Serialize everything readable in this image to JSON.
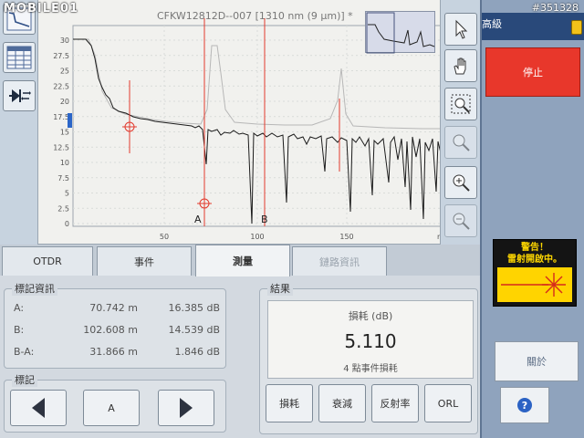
{
  "watermark": {
    "brand": "MOBILE01",
    "id": "#351328"
  },
  "graph": {
    "title": "CFKW12812D--007 [1310 nm (9 µm)] *",
    "x_ticks": [
      "50",
      "100",
      "150"
    ],
    "x_unit": "m",
    "y_ticks": [
      "30",
      "27.5",
      "25",
      "22.5",
      "20",
      "17.5",
      "15",
      "12.5",
      "10",
      "7.5",
      "5",
      "2.5",
      "0"
    ],
    "marker_a": "A",
    "marker_b": "B"
  },
  "left_tools": {
    "icons": [
      "trace-view-icon",
      "table-view-icon",
      "event-icon"
    ]
  },
  "right_tools": {
    "icons": [
      "pointer-icon",
      "hand-pan-icon",
      "zoom-area-icon",
      "zoom-reset-icon",
      "zoom-in-icon",
      "zoom-out-icon"
    ]
  },
  "side": {
    "level": "高級",
    "stop": "停止",
    "warning_line1": "警告！",
    "warning_line2": "雷射開啟中。",
    "about": "關於",
    "help": "?"
  },
  "tabs": [
    {
      "label": "OTDR"
    },
    {
      "label": "事件"
    },
    {
      "label": "測量"
    },
    {
      "label": "鏈路資訊"
    }
  ],
  "marker_info": {
    "legend": "標記資訊",
    "rows": [
      {
        "label": "A:",
        "distance": "70.742 m",
        "loss": "16.385 dB"
      },
      {
        "label": "B:",
        "distance": "102.608 m",
        "loss": "14.539 dB"
      },
      {
        "label": "B-A:",
        "distance": "31.866 m",
        "loss": "1.846 dB"
      }
    ]
  },
  "marker_ctrl": {
    "legend": "標記",
    "selected": "A"
  },
  "results": {
    "legend": "結果",
    "title": "損耗 (dB)",
    "value": "5.110",
    "subtitle": "4 點事件損耗",
    "buttons": [
      "損耗",
      "衰減",
      "反射率",
      "ORL"
    ]
  },
  "colors": {
    "stop_red": "#e8372b",
    "header_blue": "#29497a",
    "warning_yellow": "#ffd400",
    "marker_red": "#e23a2e"
  }
}
